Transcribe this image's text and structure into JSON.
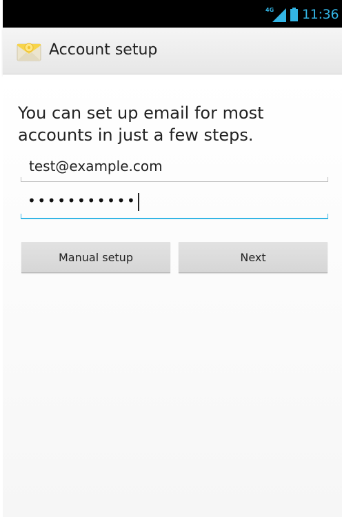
{
  "status_bar": {
    "network": "4G",
    "time": "11:36",
    "accent_color": "#33b5e5"
  },
  "action_bar": {
    "title": "Account setup",
    "icon": "email-envelope-icon"
  },
  "form": {
    "intro": "You can set up email for most accounts in just a few steps.",
    "email_value": "test@example.com",
    "password_value": "•••••••••••",
    "focused_field": "password"
  },
  "buttons": {
    "manual_setup": "Manual setup",
    "next": "Next"
  }
}
